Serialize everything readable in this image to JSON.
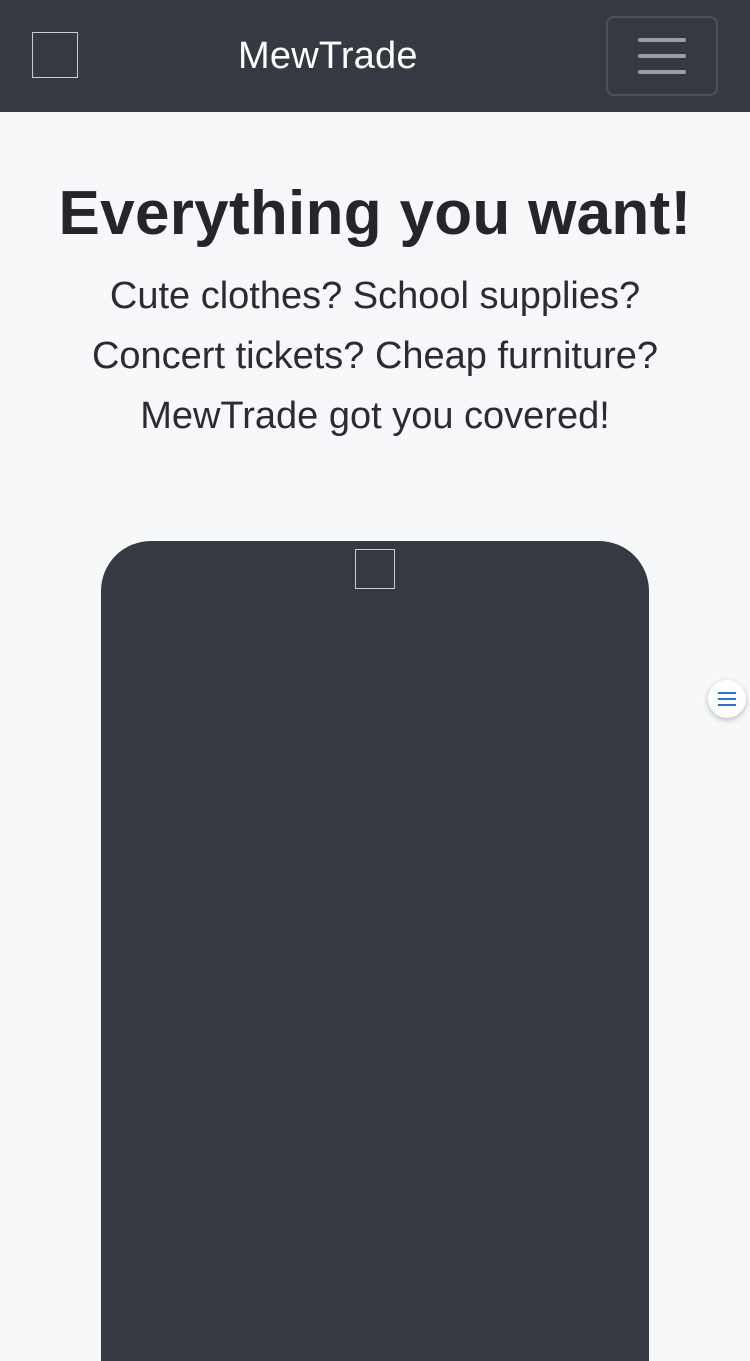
{
  "navbar": {
    "brand": "MewTrade",
    "logo_icon": "broken-image-icon",
    "menu_icon": "hamburger-menu-icon"
  },
  "hero": {
    "heading": "Everything you want!",
    "lines": [
      "Cute clothes? School supplies?",
      "Concert tickets? Cheap furniture?",
      "MewTrade got you covered!"
    ]
  },
  "phone": {
    "camera_icon": "broken-image-icon"
  },
  "floating_button": {
    "icon": "list-menu-icon",
    "color": "#2f6fd6"
  },
  "colors": {
    "navbar_bg": "#353941",
    "page_bg": "#f7f8fa",
    "text": "#24262b"
  }
}
